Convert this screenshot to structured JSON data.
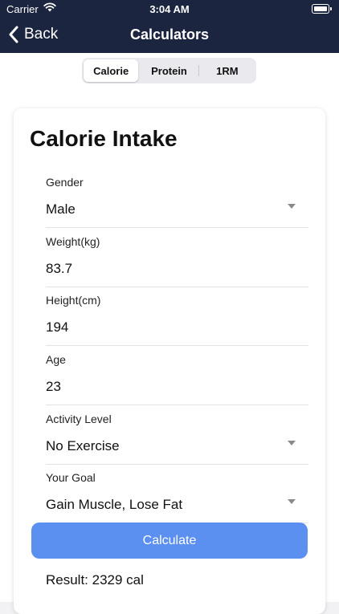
{
  "status_bar": {
    "carrier": "Carrier",
    "time": "3:04 AM"
  },
  "nav": {
    "back_label": "Back",
    "title": "Calculators"
  },
  "tabs": [
    {
      "label": "Calorie",
      "active": true
    },
    {
      "label": "Protein",
      "active": false
    },
    {
      "label": "1RM",
      "active": false
    }
  ],
  "card": {
    "title": "Calorie Intake",
    "fields": {
      "gender": {
        "label": "Gender",
        "value": "Male"
      },
      "weight": {
        "label": "Weight(kg)",
        "value": "83.7"
      },
      "height": {
        "label": "Height(cm)",
        "value": "194"
      },
      "age": {
        "label": "Age",
        "value": "23"
      },
      "activity": {
        "label": "Activity Level",
        "value": "No Exercise"
      },
      "goal": {
        "label": "Your Goal",
        "value": "Gain Muscle, Lose Fat"
      }
    },
    "calculate_label": "Calculate",
    "result": "Result: 2329 cal"
  },
  "colors": {
    "nav_bg": "#1c2540",
    "button_bg": "#5b8ff0"
  },
  "icons": {
    "back": "chevron-left-icon",
    "dropdown": "caret-down-icon",
    "wifi": "wifi-icon",
    "battery": "battery-icon"
  }
}
